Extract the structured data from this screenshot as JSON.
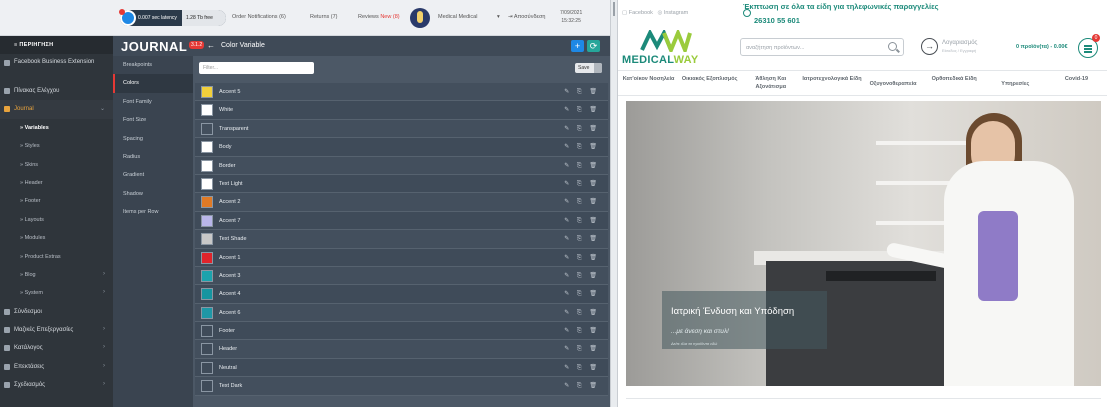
{
  "admin": {
    "topbar": {
      "latency": "0.007 sec latency",
      "free": "1.28 Tb free",
      "order_notifications": "Order Notifications (6)",
      "returns": "Returns (7)",
      "reviews": "Reviews",
      "reviews_badge": "New (8)",
      "user": "Medical Medical",
      "logout": "Αποσύνδεση",
      "date": "7/09/2021",
      "time": "15:32:25"
    },
    "sidebar": {
      "heading": "ΠΕΡΙΗΓΗΣΗ",
      "items": [
        {
          "label": "Facebook Business Extension"
        },
        {
          "label": "Πίνακας Ελέγχου"
        },
        {
          "label": "Journal"
        },
        {
          "label": "Variables"
        },
        {
          "label": "Styles"
        },
        {
          "label": "Skins"
        },
        {
          "label": "Header"
        },
        {
          "label": "Footer"
        },
        {
          "label": "Layouts"
        },
        {
          "label": "Modules"
        },
        {
          "label": "Product Extras"
        },
        {
          "label": "Blog"
        },
        {
          "label": "System"
        },
        {
          "label": "Σύνδεσμοι"
        },
        {
          "label": "Μαζικές Επεξεργασίες"
        },
        {
          "label": "Κατάλογος"
        },
        {
          "label": "Επεκτάσεις"
        },
        {
          "label": "Σχεδιασμός"
        }
      ]
    },
    "journal": {
      "logo": "JOURNAL",
      "version": "3.1.2",
      "back": "←",
      "title": "Color Variable",
      "add": "+",
      "sync": "⟳",
      "tabs": [
        "Breakpoints",
        "Colors",
        "Font Family",
        "Font Size",
        "Spacing",
        "Radius",
        "Gradient",
        "Shadow",
        "Items per Row"
      ],
      "filter_placeholder": "Filter...",
      "save_label": "Save",
      "actions": "✎ ⎘ 🗑",
      "variables": [
        {
          "name": "Accent 5",
          "color": "#f2d03b"
        },
        {
          "name": "White",
          "color": "#ffffff"
        },
        {
          "name": "Transparent",
          "color": "transparent"
        },
        {
          "name": "Body",
          "color": "#ffffff"
        },
        {
          "name": "Border",
          "color": "#ffffff"
        },
        {
          "name": "Text Light",
          "color": "#ffffff"
        },
        {
          "name": "Accent 2",
          "color": "#e07a26"
        },
        {
          "name": "Accent 7",
          "color": "#b9b6ea"
        },
        {
          "name": "Text Shade",
          "color": "#c8c8c8"
        },
        {
          "name": "Accent 1",
          "color": "#e0242b"
        },
        {
          "name": "Accent 3",
          "color": "#1ba3ad"
        },
        {
          "name": "Accent 4",
          "color": "#1595a0"
        },
        {
          "name": "Accent 6",
          "color": "#1e97a6"
        },
        {
          "name": "Footer",
          "color": "#3f4b59"
        },
        {
          "name": "Header",
          "color": "#3f4b59"
        },
        {
          "name": "Neutral",
          "color": "#3f4b59"
        },
        {
          "name": "Text Dark",
          "color": "#3f4b59"
        }
      ]
    }
  },
  "store": {
    "social_facebook": "Facebook",
    "social_instagram": "Instagram",
    "promo": "Έκπτωση σε όλα τα είδη για τηλεφωνικές παραγγελίες",
    "phone": "26310 55 601",
    "logo_main": "MEDICAL",
    "logo_accent": "WAY",
    "search_placeholder": "αναζήτηση προϊόντων...",
    "account_title": "Λογαριασμός",
    "account_sub": "Είσοδος / Εγγραφή",
    "cart": "0 προϊόν(τα) - 0.00€",
    "cart_count": "0",
    "nav": [
      "Κατ'οίκον Νοσηλεία",
      "Οικιακός Εξοπλισμός",
      "Άθληση Και Αξονάτισμα",
      "Ιατροτεχνολογικά Είδη",
      "Οξυγονοθεραπεία",
      "Ορθοπεδικά Είδη",
      "Υπηρεσίες",
      "Covid-19"
    ],
    "hero": {
      "heading": "Ιατρική Ένδυση και Υπόδηση",
      "subheading": "...με άνεση και στυλ!",
      "link": "Δείτε όλα τα προϊόντα εδώ"
    },
    "colors": {
      "brand": "#1c8a7a",
      "accent": "#9acb3c"
    }
  }
}
